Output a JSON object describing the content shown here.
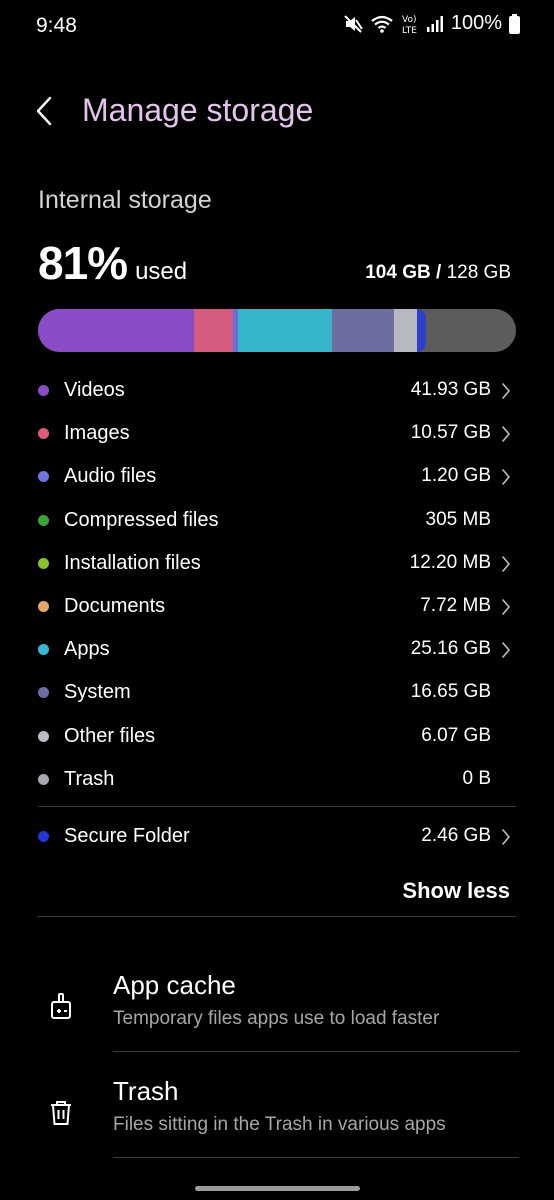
{
  "status_bar": {
    "time": "9:48",
    "battery": "100%",
    "network": "Vo) LTE"
  },
  "header": {
    "title": "Manage storage"
  },
  "storage": {
    "heading": "Internal storage",
    "percent": "81%",
    "used_word": "used",
    "used_amount": "104 GB",
    "separator": "/",
    "total_amount": "128 GB",
    "used_fraction": 0.81,
    "segment_fractions": [
      {
        "name": "Videos",
        "fraction": 0.326,
        "color": "#8a4bc6"
      },
      {
        "name": "Images",
        "fraction": 0.082,
        "color": "#d45c7e"
      },
      {
        "name": "Audio files",
        "fraction": 0.01,
        "color": "#6a6fd8"
      },
      {
        "name": "Apps",
        "fraction": 0.197,
        "color": "#37b6cb"
      },
      {
        "name": "System",
        "fraction": 0.13,
        "color": "#6d6e9f"
      },
      {
        "name": "Other files",
        "fraction": 0.047,
        "color": "#b7b8c0"
      },
      {
        "name": "Secure Folder",
        "fraction": 0.019,
        "color": "#2d3fcc"
      }
    ]
  },
  "categories": [
    {
      "label": "Videos",
      "size": "41.93 GB",
      "color": "#8a4bc6",
      "chevron": true
    },
    {
      "label": "Images",
      "size": "10.57 GB",
      "color": "#e05a7a",
      "chevron": true
    },
    {
      "label": "Audio files",
      "size": "1.20 GB",
      "color": "#6f76e0",
      "chevron": true
    },
    {
      "label": "Compressed files",
      "size": "305 MB",
      "color": "#3ba33a",
      "chevron": false
    },
    {
      "label": "Installation files",
      "size": "12.20 MB",
      "color": "#8cc32a",
      "chevron": true
    },
    {
      "label": "Documents",
      "size": "7.72 MB",
      "color": "#e5a86a",
      "chevron": true
    },
    {
      "label": "Apps",
      "size": "25.16 GB",
      "color": "#37b9d6",
      "chevron": true
    },
    {
      "label": "System",
      "size": "16.65 GB",
      "color": "#6d6ea6",
      "chevron": false
    },
    {
      "label": "Other files",
      "size": "6.07 GB",
      "color": "#b9bac2",
      "chevron": false
    },
    {
      "label": "Trash",
      "size": "0 B",
      "color": "#a7a8b0",
      "chevron": false
    }
  ],
  "secure_folder": {
    "label": "Secure Folder",
    "size": "2.46 GB",
    "color": "#2338d6"
  },
  "show_less_label": "Show less",
  "tools": [
    {
      "title": "App cache",
      "desc": "Temporary files apps use to load faster",
      "icon": "broom-icon"
    },
    {
      "title": "Trash",
      "desc": "Files sitting in the Trash in various apps",
      "icon": "trash-icon"
    }
  ]
}
